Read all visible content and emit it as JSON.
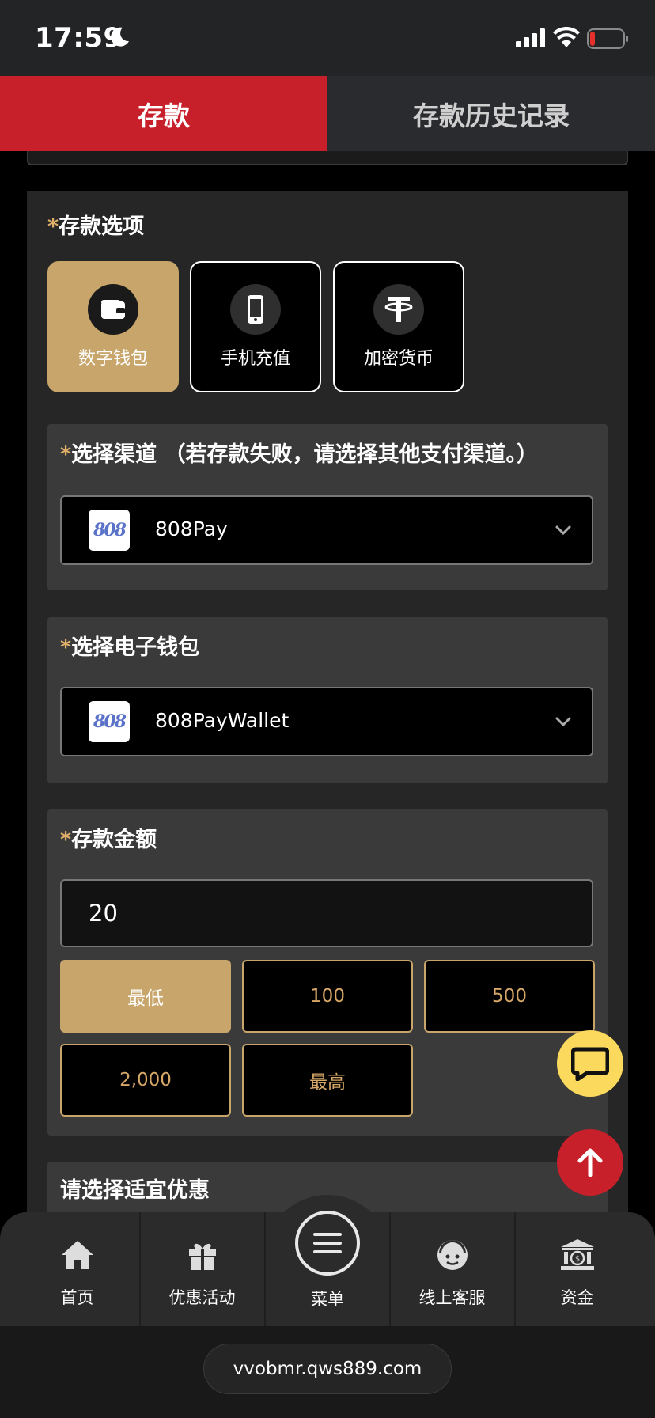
{
  "status_bar": {
    "time": "17:59"
  },
  "tabs": [
    {
      "label": "存款",
      "active": true
    },
    {
      "label": "存款历史记录",
      "active": false
    }
  ],
  "deposit_options": {
    "title": "存款选项",
    "required_mark": "*",
    "methods": [
      {
        "label": "数字钱包",
        "icon": "wallet-icon",
        "active": true
      },
      {
        "label": "手机充值",
        "icon": "phone-icon",
        "active": false
      },
      {
        "label": "加密货币",
        "icon": "tether-icon",
        "active": false
      }
    ]
  },
  "channel": {
    "title": "选择渠道 （若存款失败，请选择其他支付渠道。）",
    "required_mark": "*",
    "logo_text": "808",
    "selected": "808Pay"
  },
  "ewallet": {
    "title": "选择电子钱包",
    "required_mark": "*",
    "logo_text": "808",
    "selected": "808PayWallet"
  },
  "amount": {
    "title": "存款金额",
    "required_mark": "*",
    "value": "20",
    "chips": [
      {
        "label": "最低",
        "active": true
      },
      {
        "label": "100",
        "active": false
      },
      {
        "label": "500",
        "active": false
      },
      {
        "label": "2,000",
        "active": false
      },
      {
        "label": "最高",
        "active": false
      }
    ]
  },
  "promo": {
    "title": "请选择适宜优惠"
  },
  "bottom_nav": [
    {
      "label": "首页",
      "icon": "home-icon"
    },
    {
      "label": "优惠活动",
      "icon": "gift-icon"
    },
    {
      "label": "菜单",
      "icon": "menu-icon"
    },
    {
      "label": "线上客服",
      "icon": "support-agent-icon"
    },
    {
      "label": "资金",
      "icon": "bank-icon"
    }
  ],
  "browser": {
    "url": "vvobmr.qws889.com"
  },
  "colors": {
    "accent_red": "#c8202a",
    "gold": "#c8a56a",
    "chat_yellow": "#fbd95c"
  }
}
